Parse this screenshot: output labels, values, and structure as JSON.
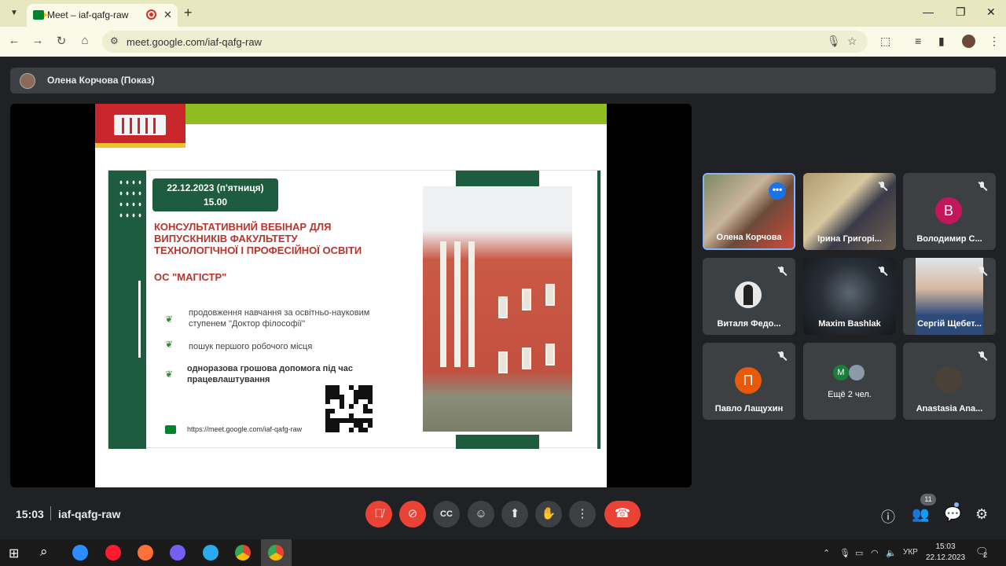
{
  "browser": {
    "tab_title": "Meet – iaf-qafg-raw",
    "url": "meet.google.com/iaf-qafg-raw"
  },
  "presenter_bar": {
    "label": "Олена Корчова (Показ)"
  },
  "slide": {
    "date": "22.12.2023 (п'ятниця)",
    "time": "15.00",
    "title_line1": "КОНСУЛЬТАТИВНИЙ ВЕБІНАР ДЛЯ",
    "title_line2": "ВИПУСКНИКІВ ФАКУЛЬТЕТУ",
    "title_line3": "ТЕХНОЛОГІЧНОЇ І ПРОФЕСІЙНОЇ ОСВІТИ",
    "subtitle": "ОС \"МАГІСТР\"",
    "bullet1_line1": "продовження навчання за освітньо-науковим",
    "bullet1_line2": "ступенем \"Доктор філософії\"",
    "bullet2": "пошук першого робочого місця",
    "bullet3_line1": "одноразова грошова допомога під час",
    "bullet3_line2": "працевлаштування",
    "link": "https://meet.google.com/iaf-qafg-raw"
  },
  "participants": [
    {
      "name": "Олена Корчова",
      "type": "video",
      "active": true
    },
    {
      "name": "Ірина Григорі...",
      "type": "video",
      "muted": true
    },
    {
      "name": "Володимир С...",
      "type": "letter",
      "letter": "В",
      "color": "#c2185b",
      "muted": true
    },
    {
      "name": "Виталя Федо...",
      "type": "avatar",
      "muted": true
    },
    {
      "name": "Maxim Bashlak",
      "type": "video",
      "muted": true
    },
    {
      "name": "Сергій Щебет...",
      "type": "video",
      "muted": true
    },
    {
      "name": "Павло Лащухин",
      "type": "letter",
      "letter": "П",
      "color": "#e8590c",
      "muted": true
    },
    {
      "name": "Ещё 2 чел.",
      "type": "more",
      "letter": "М"
    },
    {
      "name": "Anastasia Ana...",
      "type": "avatar",
      "muted": true
    }
  ],
  "meeting": {
    "time": "15:03",
    "code": "iaf-qafg-raw",
    "people_count": "11"
  },
  "taskbar": {
    "lang": "УКР",
    "time": "15:03",
    "date": "22.12.2023",
    "notif_count": "2"
  }
}
